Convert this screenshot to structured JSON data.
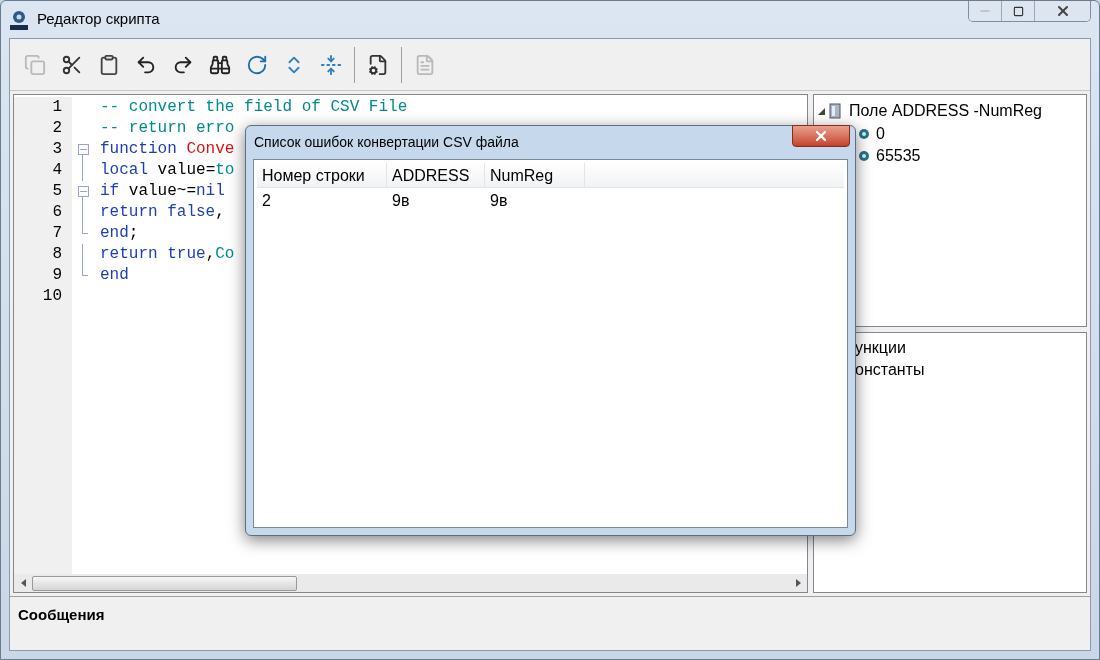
{
  "window": {
    "title": "Редактор скрипта"
  },
  "toolbar": [
    {
      "kind": "copy",
      "disabled": true
    },
    {
      "kind": "cut",
      "disabled": false
    },
    {
      "kind": "paste",
      "disabled": false
    },
    {
      "kind": "undo",
      "disabled": false
    },
    {
      "kind": "redo",
      "disabled": false
    },
    {
      "kind": "find",
      "disabled": false
    },
    {
      "kind": "refresh",
      "disabled": false
    },
    {
      "kind": "expand",
      "disabled": false
    },
    {
      "kind": "collapse",
      "disabled": false
    },
    {
      "kind": "sep"
    },
    {
      "kind": "run",
      "disabled": false
    },
    {
      "kind": "sep"
    },
    {
      "kind": "doc",
      "disabled": true
    }
  ],
  "editor": {
    "lines": [
      {
        "number": "1",
        "kind": "plain",
        "tokens": [
          {
            "kind": "comment",
            "text": "-- convert the field of CSV File"
          }
        ]
      },
      {
        "number": "2",
        "kind": "plain",
        "tokens": [
          {
            "kind": "comment",
            "text": "-- return erro"
          }
        ]
      },
      {
        "number": "3",
        "kind": "block_start",
        "tokens": [
          {
            "kind": "keyword",
            "text": "function"
          },
          {
            "kind": "function",
            "text": " Conve"
          }
        ]
      },
      {
        "number": "4",
        "kind": "block_body",
        "tokens": [
          {
            "kind": "keyword",
            "text": "local"
          },
          {
            "kind": "plain",
            "text": " value="
          },
          {
            "kind": "builtin",
            "text": "to"
          }
        ]
      },
      {
        "number": "5",
        "kind": "block_start",
        "tokens": [
          {
            "kind": "keyword",
            "text": "if"
          },
          {
            "kind": "plain",
            "text": " value~="
          },
          {
            "kind": "keyword",
            "text": "nil"
          }
        ]
      },
      {
        "number": "6",
        "kind": "block_body",
        "tokens": [
          {
            "kind": "keyword",
            "text": "return false"
          },
          {
            "kind": "plain",
            "text": ","
          }
        ]
      },
      {
        "number": "7",
        "kind": "block_end",
        "tokens": [
          {
            "kind": "keyword",
            "text": "end"
          },
          {
            "kind": "plain",
            "text": ";"
          }
        ]
      },
      {
        "number": "8",
        "kind": "block_body",
        "tokens": [
          {
            "kind": "keyword",
            "text": "return true"
          },
          {
            "kind": "plain",
            "text": ","
          },
          {
            "kind": "builtin",
            "text": "Co"
          }
        ]
      },
      {
        "number": "9",
        "kind": "block_end",
        "tokens": [
          {
            "kind": "keyword",
            "text": "end"
          }
        ]
      },
      {
        "number": "10",
        "kind": "plain"
      }
    ]
  },
  "tree": {
    "label": "Поле ADDRESS -NumReg",
    "expanded": true,
    "children": [
      {
        "label": "0"
      },
      {
        "label": "65535"
      }
    ]
  },
  "library": {
    "items": [
      "ункции",
      "онстанты"
    ]
  },
  "messages": {
    "title": "Сообщения"
  },
  "dialog": {
    "title": "Список ошибок конвертации CSV файла",
    "columns": [
      "Номер строки",
      "ADDRESS",
      "NumReg"
    ],
    "rows": [
      [
        "2",
        "9в",
        "9в"
      ]
    ]
  }
}
